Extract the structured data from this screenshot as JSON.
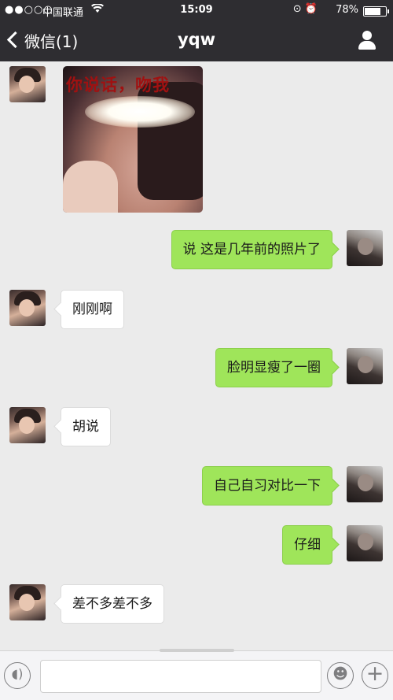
{
  "status_bar": {
    "signal": "●●○○○",
    "carrier": "中国联通",
    "wifi_icon": "wifi-icon",
    "time": "15:09",
    "battery_percent": "78%",
    "battery_level": 0.78,
    "icons": "⊙ ⏰"
  },
  "nav": {
    "back_label": "微信(1)",
    "title": "yqw",
    "profile_icon": "person-icon"
  },
  "messages": [
    {
      "side": "left",
      "type": "image",
      "caption": "你说话，吻我"
    },
    {
      "side": "right",
      "text": "说 这是几年前的照片了"
    },
    {
      "side": "left",
      "text": "刚刚啊"
    },
    {
      "side": "right",
      "text": "脸明显瘦了一圈"
    },
    {
      "side": "left",
      "text": "胡说"
    },
    {
      "side": "right",
      "text": "自己自习对比一下"
    },
    {
      "side": "right",
      "text": "仔细"
    },
    {
      "side": "left",
      "text": "差不多差不多"
    }
  ],
  "input_bar": {
    "voice_icon": "voice-icon",
    "emoji_icon": "emoji-icon",
    "plus_icon": "plus-icon",
    "text_value": ""
  },
  "colors": {
    "nav_bg": "#2e2d31",
    "chat_bg": "#ebebeb",
    "bubble_sent": "#9fe55a",
    "bubble_received": "#ffffff"
  }
}
